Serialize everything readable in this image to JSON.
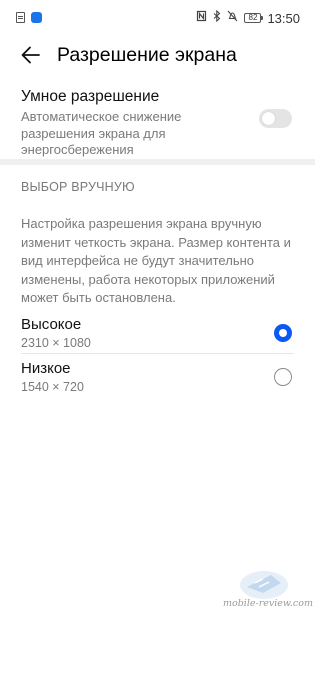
{
  "status_bar": {
    "icons": [
      "document-icon",
      "app-icon",
      "nfc-icon",
      "bluetooth-icon",
      "silent-icon"
    ],
    "battery": "82",
    "time": "13:50"
  },
  "header": {
    "title": "Разрешение экрана",
    "back_icon": "back-arrow-icon"
  },
  "smart_resolution": {
    "title": "Умное разрешение",
    "description": "Автоматическое снижение разрешения экрана для энергосбережения",
    "enabled": false
  },
  "manual": {
    "section_title": "ВЫБОР ВРУЧНУЮ",
    "description": "Настройка разрешения экрана вручную изменит четкость экрана. Размер контента и вид интерфейса не будут значительно изменены, работа некоторых приложений может быть остановлена.",
    "options": [
      {
        "label": "Высокое",
        "value": "2310 × 1080",
        "selected": true
      },
      {
        "label": "Низкое",
        "value": "1540 × 720",
        "selected": false
      }
    ]
  },
  "watermark": {
    "text": "mobile-review.com"
  },
  "colors": {
    "accent": "#0a59f7",
    "secondary_text": "#7a7a7a",
    "divider": "#f0f0f0"
  }
}
